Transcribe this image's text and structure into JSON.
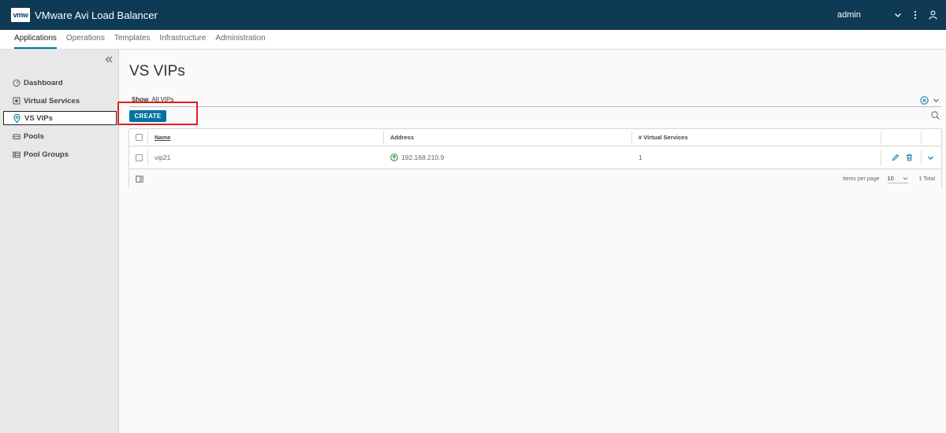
{
  "header": {
    "logo_text": "vmw",
    "app_title": "VMware Avi Load Balancer",
    "user": "admin"
  },
  "nav_tabs": [
    {
      "label": "Applications",
      "active": true
    },
    {
      "label": "Operations",
      "active": false
    },
    {
      "label": "Templates",
      "active": false
    },
    {
      "label": "Infrastructure",
      "active": false
    },
    {
      "label": "Administration",
      "active": false
    }
  ],
  "sidebar": {
    "items": [
      {
        "label": "Dashboard",
        "icon": "dashboard-icon"
      },
      {
        "label": "Virtual Services",
        "icon": "virtual-services-icon"
      },
      {
        "label": "VS VIPs",
        "icon": "location-pin-icon",
        "active": true
      },
      {
        "label": "Pools",
        "icon": "pool-icon"
      },
      {
        "label": "Pool Groups",
        "icon": "pool-groups-icon"
      }
    ]
  },
  "page": {
    "title": "VS VIPs",
    "show_label": "Show",
    "show_value": "All VIPs",
    "create_label": "CREATE"
  },
  "table": {
    "columns": [
      "Name",
      "Address",
      "# Virtual Services"
    ],
    "rows": [
      {
        "name": "vip21",
        "address": "192.168.210.9",
        "virtual_services": "1",
        "status": "up"
      }
    ],
    "footer": {
      "items_per_page_label": "items per page",
      "items_per_page_value": "10",
      "total": "1 Total"
    }
  },
  "colors": {
    "header_bg": "#0e3a55",
    "accent": "#0072a3",
    "status_up": "#2e8b2e",
    "highlight": "#e51c1c"
  }
}
